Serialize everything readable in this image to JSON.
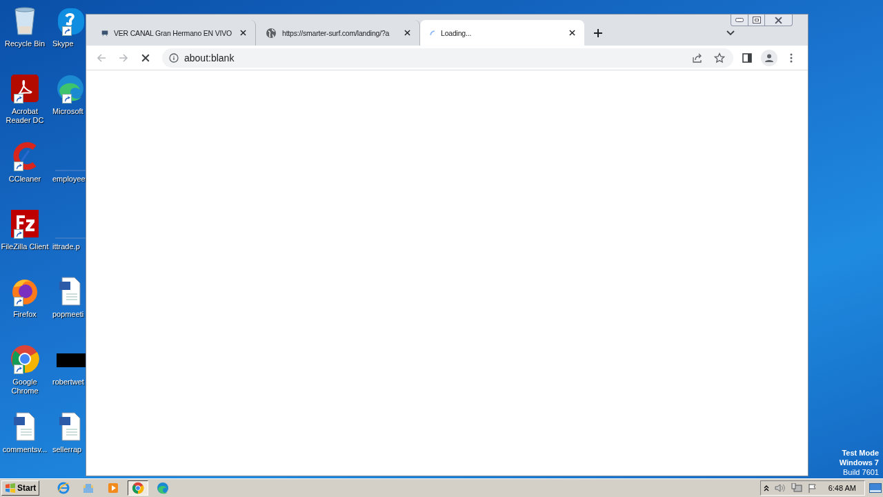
{
  "desktop": {
    "icons": [
      {
        "label": "Recycle Bin",
        "kind": "recycle",
        "shortcut": false
      },
      {
        "label": "Skype",
        "kind": "skype",
        "shortcut": true
      },
      {
        "label": "Acrobat Reader DC",
        "kind": "acrobat",
        "shortcut": true
      },
      {
        "label": "Microsoft",
        "kind": "edge",
        "shortcut": true
      },
      {
        "label": "CCleaner",
        "kind": "ccleaner",
        "shortcut": true
      },
      {
        "label": "employee",
        "kind": "blank",
        "shortcut": false
      },
      {
        "label": "FileZilla Client",
        "kind": "filezilla",
        "shortcut": true
      },
      {
        "label": "ittrade.p",
        "kind": "blank",
        "shortcut": false
      },
      {
        "label": "Firefox",
        "kind": "firefox",
        "shortcut": true
      },
      {
        "label": "popmeeti",
        "kind": "word",
        "shortcut": false
      },
      {
        "label": "Google Chrome",
        "kind": "chrome",
        "shortcut": true
      },
      {
        "label": "robertwet",
        "kind": "dark",
        "shortcut": false
      },
      {
        "label": "commentsv...",
        "kind": "word",
        "shortcut": false
      },
      {
        "label": "sellerrap",
        "kind": "word",
        "shortcut": false
      }
    ],
    "notice": [
      "Test Mode",
      "Windows 7",
      "Build 7601"
    ]
  },
  "browser": {
    "tabs": [
      {
        "title": "VER CANAL Gran Hermano EN VIVO",
        "kind": "tv",
        "selected": false
      },
      {
        "title": "https://smarter-surf.com/landing/?a",
        "kind": "globe",
        "selected": false
      },
      {
        "title": "Loading...",
        "kind": "spinner",
        "selected": true
      }
    ],
    "loading": true,
    "address": "about:blank"
  },
  "taskbar": {
    "start": "Start",
    "apps": [
      {
        "kind": "ie",
        "active": false
      },
      {
        "kind": "folder",
        "active": false
      },
      {
        "kind": "media",
        "active": false
      },
      {
        "kind": "chrome",
        "active": true
      },
      {
        "kind": "edge",
        "active": false
      }
    ],
    "clock": "6:48 AM"
  }
}
